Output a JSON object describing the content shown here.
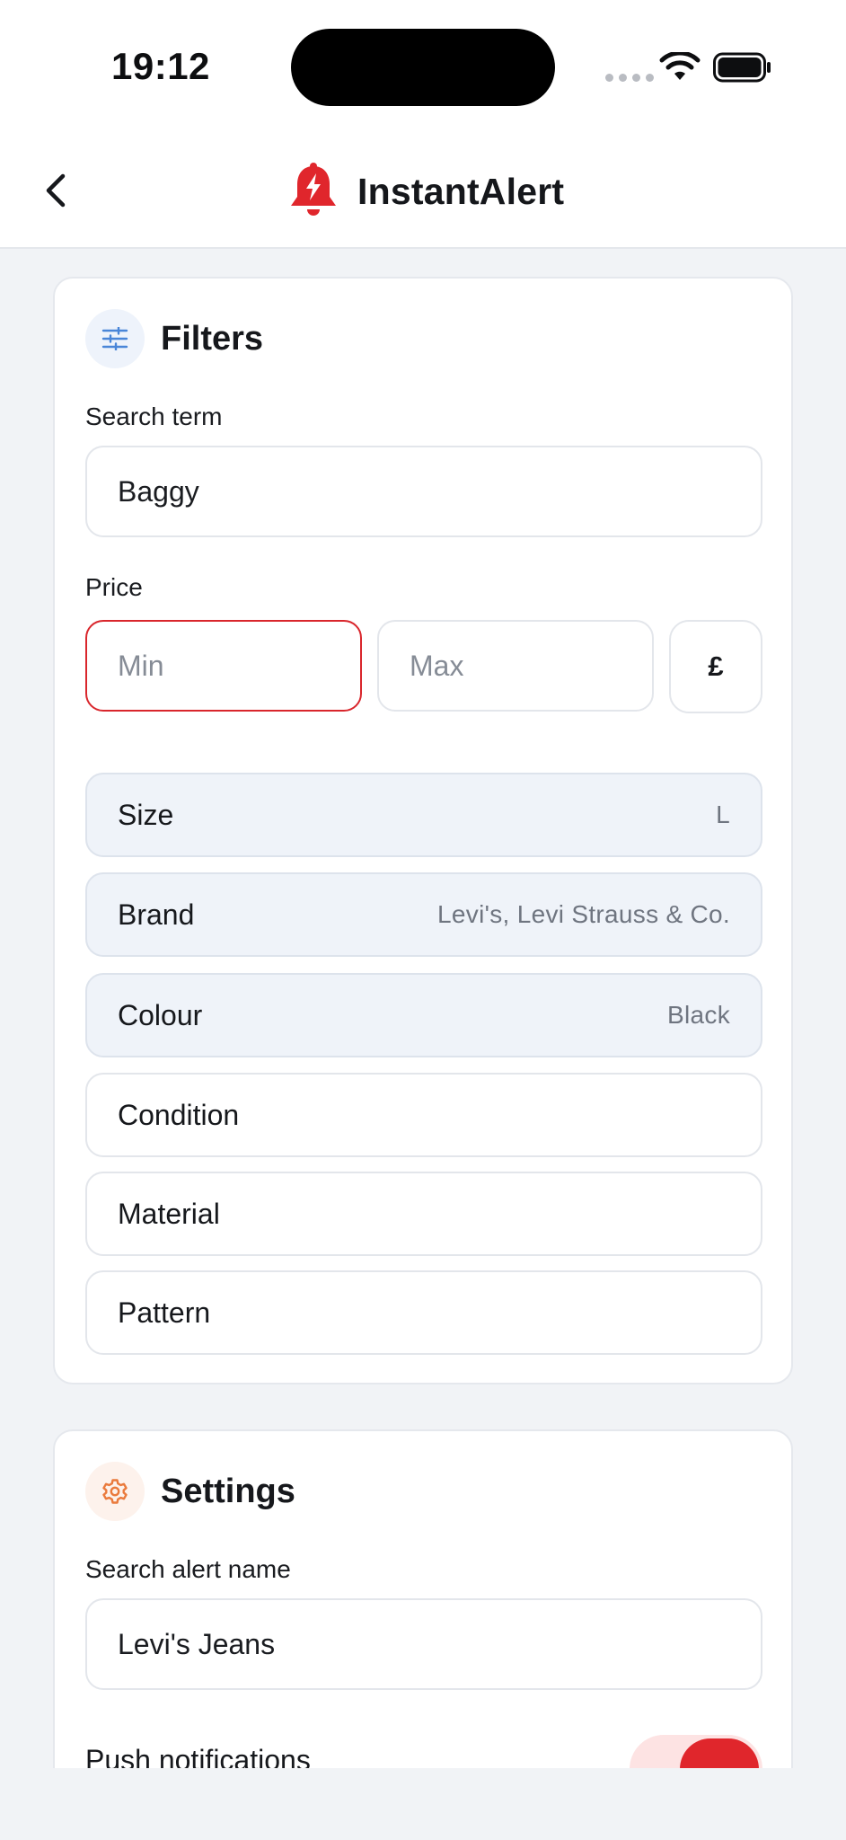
{
  "status_bar": {
    "time": "19:12"
  },
  "nav": {
    "app_title": "InstantAlert",
    "back_icon": "chevron-left-icon",
    "logo_icon": "bell-bolt-icon",
    "brand_color": "#e0262c"
  },
  "filters": {
    "title": "Filters",
    "icon": "sliders-icon",
    "search_term": {
      "label": "Search term",
      "value": "Baggy"
    },
    "price": {
      "label": "Price",
      "min_placeholder": "Min",
      "max_placeholder": "Max",
      "currency": "£"
    },
    "rows": [
      {
        "label": "Size",
        "value": "L"
      },
      {
        "label": "Brand",
        "value": "Levi's, Levi Strauss & Co."
      },
      {
        "label": "Colour",
        "value": "Black"
      },
      {
        "label": "Condition",
        "value": ""
      },
      {
        "label": "Material",
        "value": ""
      },
      {
        "label": "Pattern",
        "value": ""
      }
    ]
  },
  "settings": {
    "title": "Settings",
    "icon": "gear-icon",
    "alert_name": {
      "label": "Search alert name",
      "value": "Levi's Jeans"
    },
    "push_notifications": {
      "label": "Push notifications",
      "enabled": true
    }
  }
}
